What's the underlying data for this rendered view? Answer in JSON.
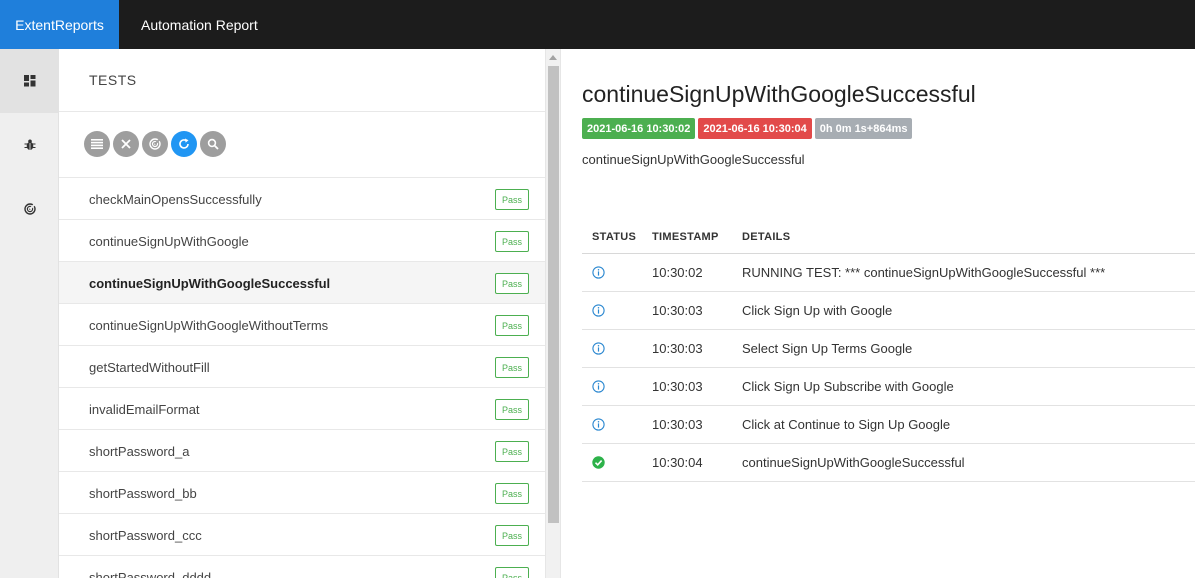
{
  "header": {
    "brand": "ExtentReports",
    "title": "Automation Report"
  },
  "rail": {
    "items": [
      {
        "name": "dashboard",
        "icon": "dashboard-icon"
      },
      {
        "name": "bug",
        "icon": "bug-icon"
      },
      {
        "name": "analytics",
        "icon": "analytics-icon"
      }
    ]
  },
  "list": {
    "header": "TESTS",
    "toolbar": [
      {
        "icon": "list-icon"
      },
      {
        "icon": "close-icon"
      },
      {
        "icon": "filter-icon"
      },
      {
        "icon": "refresh-icon"
      },
      {
        "icon": "search-icon"
      }
    ],
    "tests": [
      {
        "name": "checkMainOpensSuccessfully",
        "status": "Pass"
      },
      {
        "name": "continueSignUpWithGoogle",
        "status": "Pass"
      },
      {
        "name": "continueSignUpWithGoogleSuccessful",
        "status": "Pass"
      },
      {
        "name": "continueSignUpWithGoogleWithoutTerms",
        "status": "Pass"
      },
      {
        "name": "getStartedWithoutFill",
        "status": "Pass"
      },
      {
        "name": "invalidEmailFormat",
        "status": "Pass"
      },
      {
        "name": "shortPassword_a",
        "status": "Pass"
      },
      {
        "name": "shortPassword_bb",
        "status": "Pass"
      },
      {
        "name": "shortPassword_ccc",
        "status": "Pass"
      },
      {
        "name": "shortPassword_dddd",
        "status": "Pass"
      }
    ]
  },
  "detail": {
    "title": "continueSignUpWithGoogleSuccessful",
    "start_time": "2021-06-16 10:30:02",
    "end_time": "2021-06-16 10:30:04",
    "duration": "0h 0m 1s+864ms",
    "description": "continueSignUpWithGoogleSuccessful",
    "columns": {
      "status": "STATUS",
      "timestamp": "TIMESTAMP",
      "details": "DETAILS"
    },
    "logs": [
      {
        "status": "info",
        "timestamp": "10:30:02",
        "details": "RUNNING TEST: *** continueSignUpWithGoogleSuccessful ***"
      },
      {
        "status": "info",
        "timestamp": "10:30:03",
        "details": "Click Sign Up with Google"
      },
      {
        "status": "info",
        "timestamp": "10:30:03",
        "details": "Select Sign Up Terms Google"
      },
      {
        "status": "info",
        "timestamp": "10:30:03",
        "details": "Click Sign Up Subscribe with Google"
      },
      {
        "status": "info",
        "timestamp": "10:30:03",
        "details": "Click at Continue to Sign Up Google"
      },
      {
        "status": "pass",
        "timestamp": "10:30:04",
        "details": "continueSignUpWithGoogleSuccessful"
      }
    ]
  },
  "colors": {
    "brand": "#1f7fdb",
    "topbar": "#1c1c1c",
    "pass": "#4caf50",
    "fail": "#e24a4a",
    "info": "#2a87d0"
  }
}
